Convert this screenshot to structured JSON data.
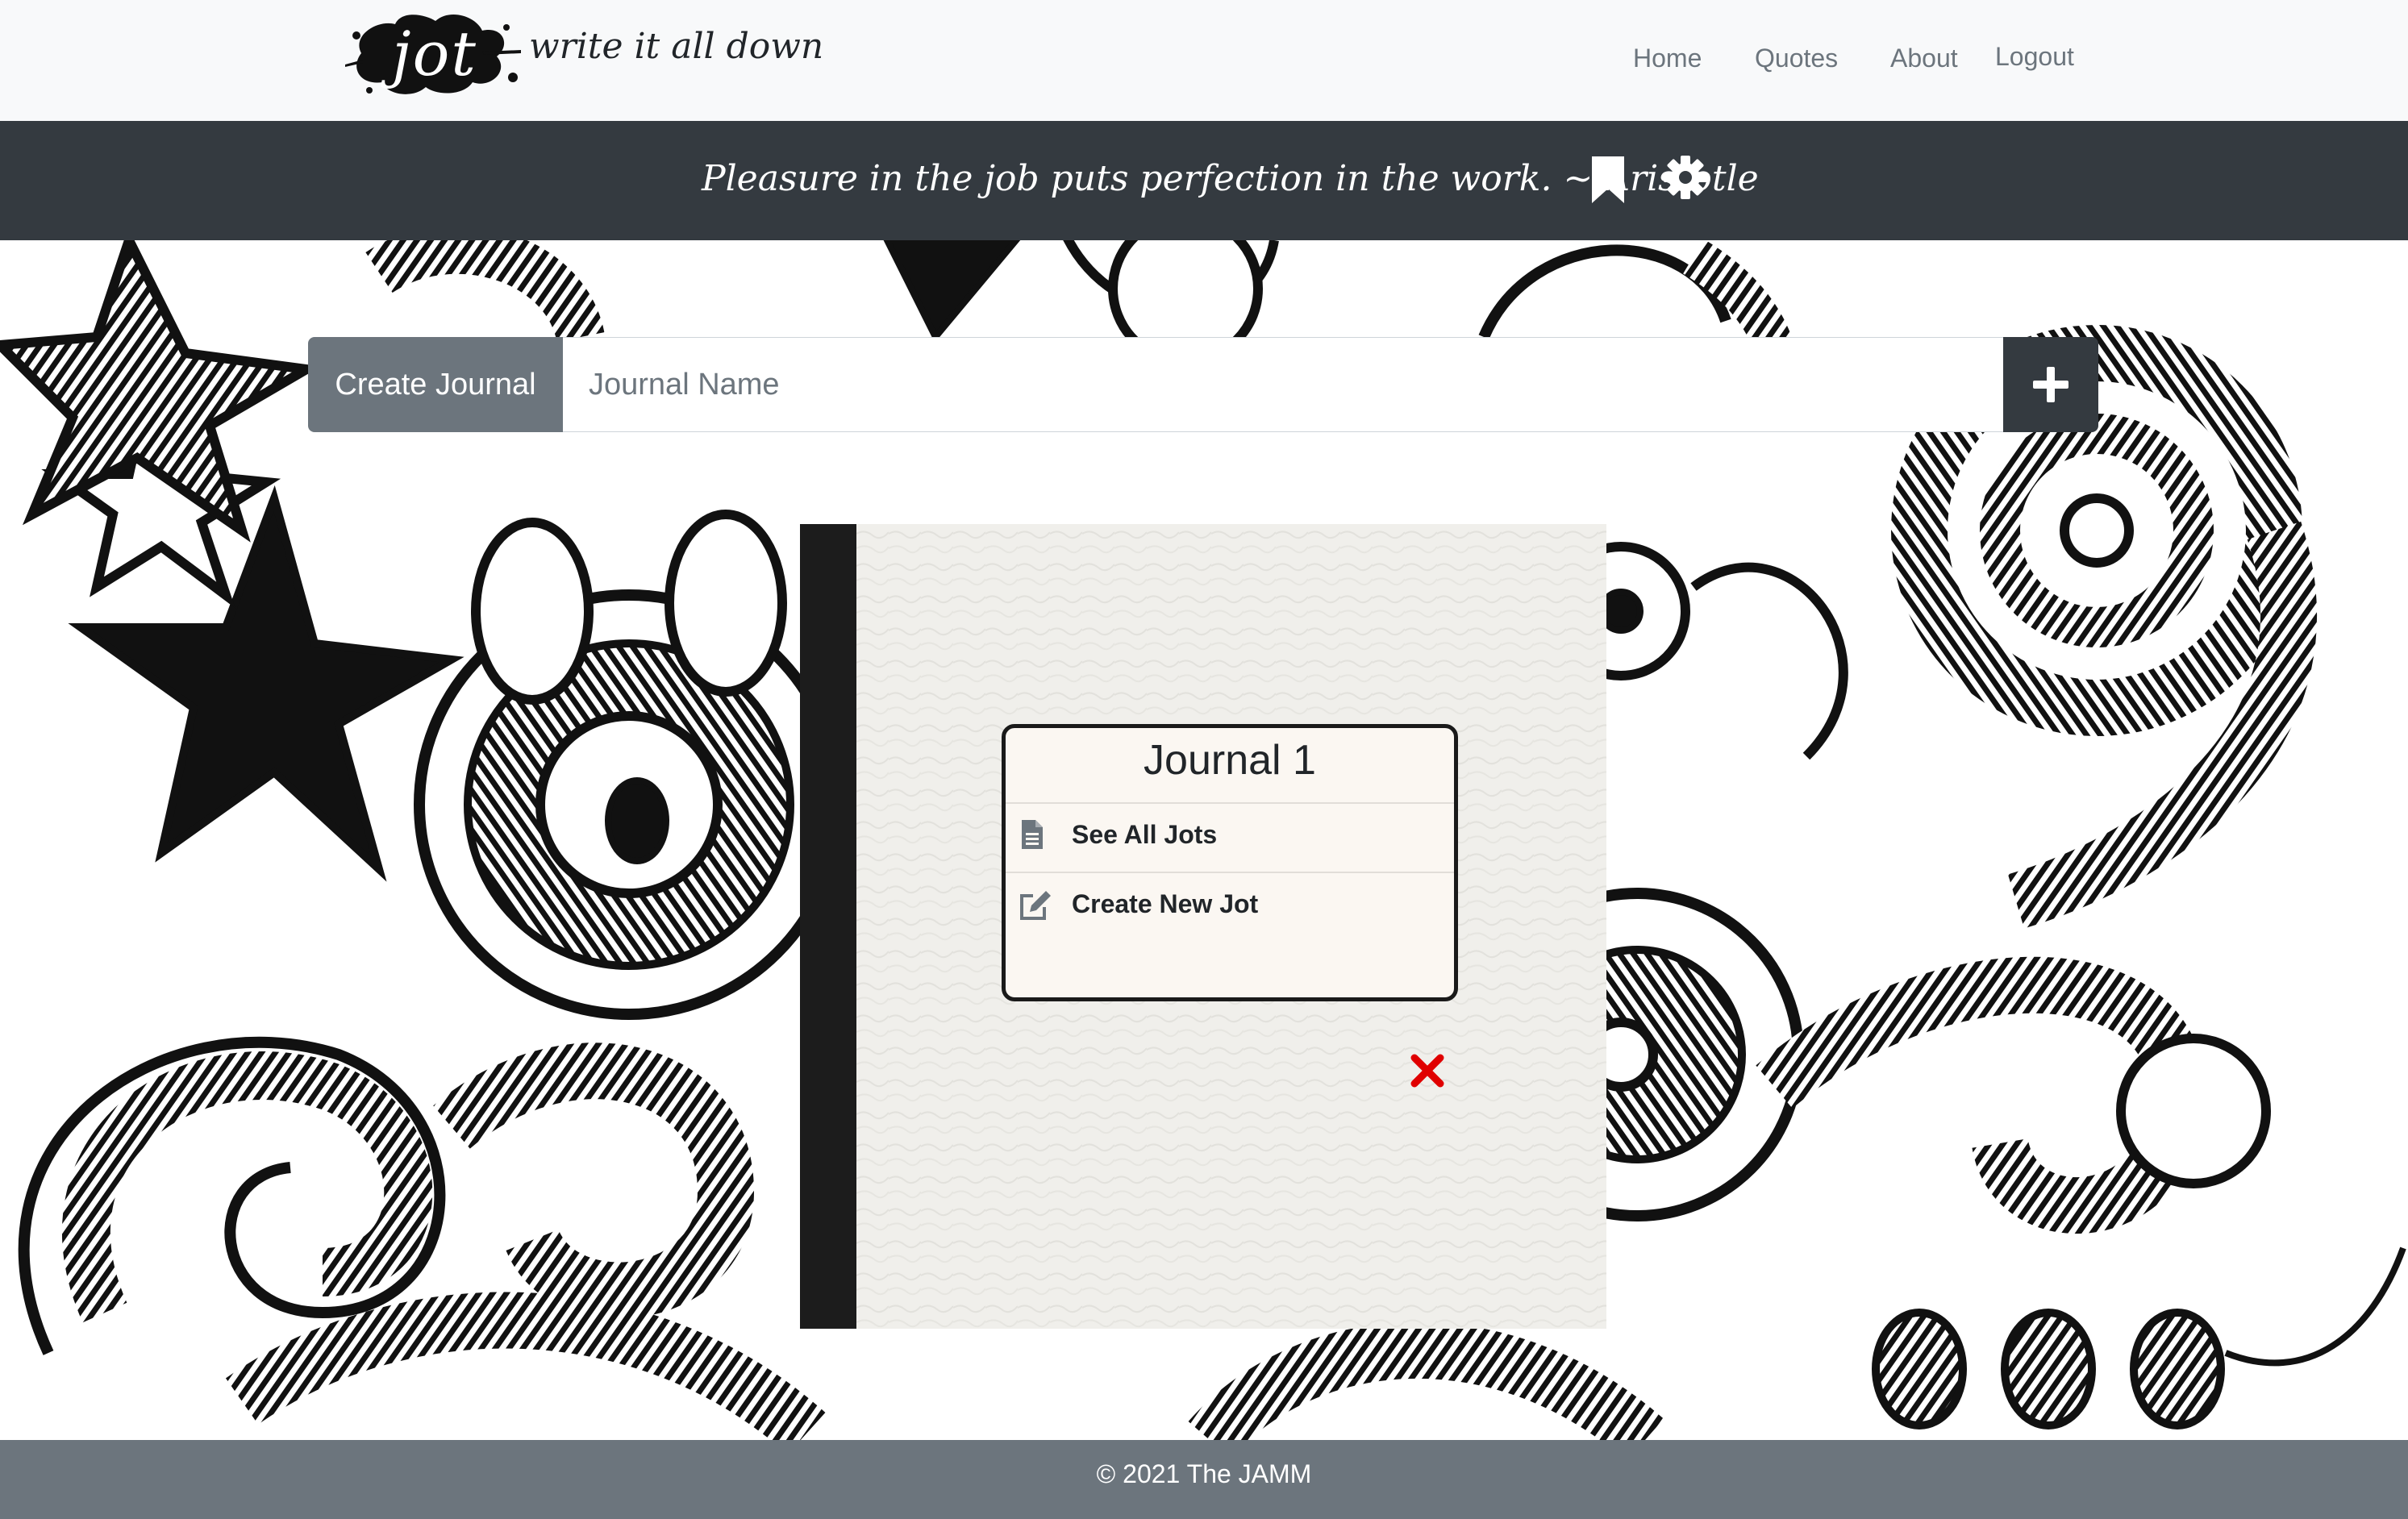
{
  "header": {
    "logo_text": "jot",
    "tagline": "write it all down",
    "nav": [
      {
        "label": "Home"
      },
      {
        "label": "Quotes"
      },
      {
        "label": "About"
      },
      {
        "label": "Logout"
      }
    ]
  },
  "quote_bar": {
    "quote": "Pleasure in the job puts perfection in the work. ~ Aristotle",
    "icons": [
      "bookmark-icon",
      "gear-icon"
    ]
  },
  "create_journal": {
    "label": "Create Journal",
    "placeholder": "Journal Name",
    "value": "",
    "add_icon": "plus-icon"
  },
  "journal": {
    "title": "Journal 1",
    "actions": [
      {
        "label": "See All Jots",
        "icon": "document-icon"
      },
      {
        "label": "Create New Jot",
        "icon": "edit-icon"
      }
    ],
    "delete_icon": "close-icon",
    "delete_color": "#e00000"
  },
  "footer": {
    "text": "© 2021 The JAMM"
  },
  "colors": {
    "navbar_bg": "#f8f9fa",
    "quote_bar_bg": "#343a40",
    "footer_bg": "#6c757d",
    "create_label_bg": "#6c757d",
    "book_spine": "#1c1c1c",
    "book_cover": "#f0efeb"
  }
}
